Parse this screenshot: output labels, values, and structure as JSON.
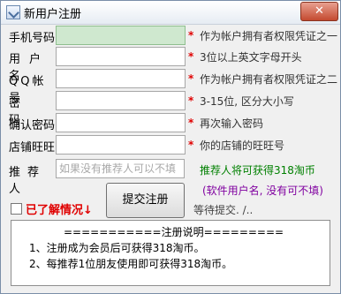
{
  "window": {
    "title": "新用户注册",
    "close_glyph": "✕"
  },
  "form": {
    "rows": [
      {
        "label": "手机号码",
        "hint": "作为帐户拥有者权限凭证之一"
      },
      {
        "label": "用户名",
        "hint": "3位以上英文字母开头"
      },
      {
        "label": "QQ帐号",
        "hint": "作为帐户拥有者权限凭证之二"
      },
      {
        "label": "密码",
        "hint": "3-15位, 区分大小写"
      },
      {
        "label": "确认密码",
        "hint": "再次输入密码"
      },
      {
        "label": "店铺旺旺",
        "hint": "你的店铺的旺旺号"
      }
    ],
    "required_mark": "*",
    "referrer": {
      "label": "推荐人",
      "placeholder": "如果没有推荐人可以不填",
      "hint": "推荐人将可获得318淘币",
      "sub_hint": "(软件用户名, 没有可不填)"
    }
  },
  "agree": {
    "label": "已了解情况↓",
    "checked": false
  },
  "submit": {
    "label": "提交注册"
  },
  "status": {
    "text": "等待提交. /.."
  },
  "notes": {
    "title": "===========注册说明=========",
    "lines": [
      "1、注册成为会员后可获得318淘币。",
      "2、每推荐1位朋友使用即可获得318淘币。"
    ]
  },
  "colors": {
    "required": "#e00000",
    "referrer_hint": "#008000",
    "referrer_sub_hint": "#8000a0",
    "phone_field_bg": "#cfe8cf"
  }
}
